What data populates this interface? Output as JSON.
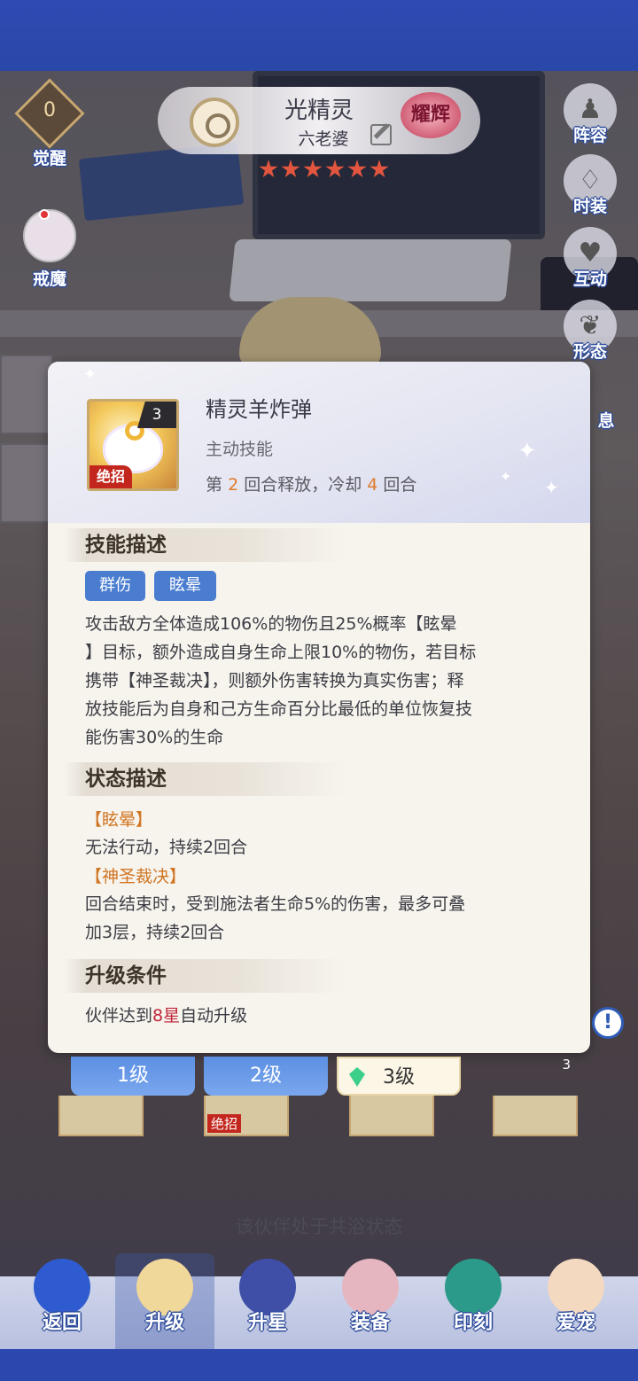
{
  "header": {
    "hero_name": "光精灵",
    "hero_nickname": "六老婆",
    "glory_badge": "耀辉",
    "stars": 6
  },
  "left_panel": {
    "awaken_count": "0",
    "awaken_label": "觉醒",
    "demon_label": "戒魔"
  },
  "right_panel": {
    "lineup": "阵容",
    "costume": "时装",
    "interact": "互动",
    "form": "形态",
    "info_partial": "息"
  },
  "skill_dialog": {
    "icon_level": "3",
    "ult_tag": "绝招",
    "name": "精灵羊炸弹",
    "type": "主动技能",
    "release": {
      "prefix": "第",
      "turn": "2",
      "mid": "回合释放，冷却",
      "cooldown": "4",
      "suffix": "回合"
    },
    "desc_title": "技能描述",
    "tags": [
      "群伤",
      "眩晕"
    ],
    "desc_lines": [
      "攻击敌方全体造成106%的物伤且25%概率【眩晕",
      "】目标，额外造成自身生命上限10%的物伤，若目标",
      "携带【神圣裁决】，则额外伤害转换为真实伤害；释",
      "放技能后为自身和己方生命百分比最低的单位恢复技",
      "能伤害30%的生命"
    ],
    "status_title": "状态描述",
    "status": [
      {
        "name": "【眩晕】",
        "lines": [
          "无法行动，持续2回合"
        ]
      },
      {
        "name": "【神圣裁决】",
        "lines": [
          "回合结束时，受到施法者生命5%的伤害，最多可叠",
          "加3层，持续2回合"
        ]
      }
    ],
    "upgrade_title": "升级条件",
    "upgrade": {
      "prefix": "伙伴达到",
      "star": "8星",
      "suffix": "自动升级"
    }
  },
  "level_tabs": [
    "1级",
    "2级",
    "3级"
  ],
  "level_card_badge": "3",
  "card_ult_tag": "绝招",
  "bath_status": "该伙伴处于共浴状态",
  "nav": [
    {
      "label": "返回",
      "icon": "back-icon"
    },
    {
      "label": "升级",
      "icon": "level-up-icon"
    },
    {
      "label": "升星",
      "icon": "star-up-icon"
    },
    {
      "label": "装备",
      "icon": "equipment-icon"
    },
    {
      "label": "印刻",
      "icon": "imprint-icon"
    },
    {
      "label": "爱宠",
      "icon": "pet-icon"
    }
  ],
  "colors": {
    "accent_orange": "#e07a2a",
    "accent_red": "#c0283a",
    "tag_blue": "#4a7dd0",
    "frame_blue": "#2d4bb3"
  }
}
